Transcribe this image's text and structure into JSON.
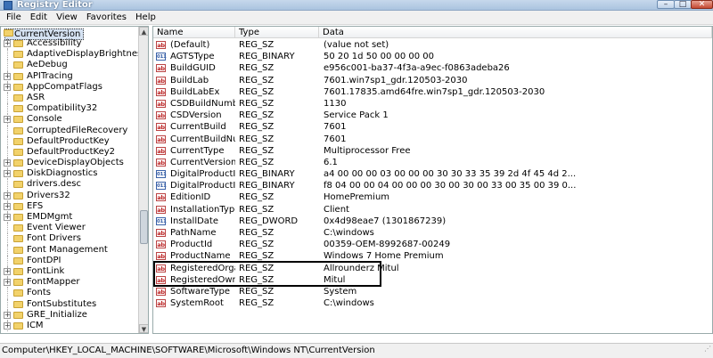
{
  "window": {
    "title": "Registry Editor",
    "min": "–",
    "max": "□",
    "close": "✕"
  },
  "menu": [
    "File",
    "Edit",
    "View",
    "Favorites",
    "Help"
  ],
  "tree": {
    "selected": "CurrentVersion",
    "items": [
      {
        "label": "Accessibility",
        "expandable": true
      },
      {
        "label": "AdaptiveDisplayBrightness",
        "expandable": false
      },
      {
        "label": "AeDebug",
        "expandable": false
      },
      {
        "label": "APITracing",
        "expandable": true
      },
      {
        "label": "AppCompatFlags",
        "expandable": true
      },
      {
        "label": "ASR",
        "expandable": false
      },
      {
        "label": "Compatibility32",
        "expandable": false
      },
      {
        "label": "Console",
        "expandable": true
      },
      {
        "label": "CorruptedFileRecovery",
        "expandable": false
      },
      {
        "label": "DefaultProductKey",
        "expandable": false
      },
      {
        "label": "DefaultProductKey2",
        "expandable": false
      },
      {
        "label": "DeviceDisplayObjects",
        "expandable": true
      },
      {
        "label": "DiskDiagnostics",
        "expandable": true
      },
      {
        "label": "drivers.desc",
        "expandable": false
      },
      {
        "label": "Drivers32",
        "expandable": true
      },
      {
        "label": "EFS",
        "expandable": true
      },
      {
        "label": "EMDMgmt",
        "expandable": true
      },
      {
        "label": "Event Viewer",
        "expandable": false
      },
      {
        "label": "Font Drivers",
        "expandable": false
      },
      {
        "label": "Font Management",
        "expandable": false
      },
      {
        "label": "FontDPI",
        "expandable": false
      },
      {
        "label": "FontLink",
        "expandable": true
      },
      {
        "label": "FontMapper",
        "expandable": true
      },
      {
        "label": "Fonts",
        "expandable": false
      },
      {
        "label": "FontSubstitutes",
        "expandable": false
      },
      {
        "label": "GRE_Initialize",
        "expandable": true
      },
      {
        "label": "ICM",
        "expandable": true
      }
    ]
  },
  "columns": {
    "name": "Name",
    "type": "Type",
    "data": "Data"
  },
  "rows": [
    {
      "icon": "ab",
      "name": "(Default)",
      "type": "REG_SZ",
      "data": "(value not set)"
    },
    {
      "icon": "bin",
      "name": "AGTSType",
      "type": "REG_BINARY",
      "data": "50 20 1d 50 00 00 00 00"
    },
    {
      "icon": "ab",
      "name": "BuildGUID",
      "type": "REG_SZ",
      "data": "e956c001-ba37-4f3a-a9ec-f0863adeba26"
    },
    {
      "icon": "ab",
      "name": "BuildLab",
      "type": "REG_SZ",
      "data": "7601.win7sp1_gdr.120503-2030"
    },
    {
      "icon": "ab",
      "name": "BuildLabEx",
      "type": "REG_SZ",
      "data": "7601.17835.amd64fre.win7sp1_gdr.120503-2030"
    },
    {
      "icon": "ab",
      "name": "CSDBuildNumber",
      "type": "REG_SZ",
      "data": "1130"
    },
    {
      "icon": "ab",
      "name": "CSDVersion",
      "type": "REG_SZ",
      "data": "Service Pack 1"
    },
    {
      "icon": "ab",
      "name": "CurrentBuild",
      "type": "REG_SZ",
      "data": "7601"
    },
    {
      "icon": "ab",
      "name": "CurrentBuildNumber",
      "type": "REG_SZ",
      "data": "7601"
    },
    {
      "icon": "ab",
      "name": "CurrentType",
      "type": "REG_SZ",
      "data": "Multiprocessor Free"
    },
    {
      "icon": "ab",
      "name": "CurrentVersion",
      "type": "REG_SZ",
      "data": "6.1"
    },
    {
      "icon": "bin",
      "name": "DigitalProductId",
      "type": "REG_BINARY",
      "data": "a4 00 00 00 03 00 00 00 30 30 33 35 39 2d 4f 45 4d 2..."
    },
    {
      "icon": "bin",
      "name": "DigitalProductId4",
      "type": "REG_BINARY",
      "data": "f8 04 00 00 04 00 00 00 30 00 30 00 33 00 35 00 39 0..."
    },
    {
      "icon": "ab",
      "name": "EditionID",
      "type": "REG_SZ",
      "data": "HomePremium"
    },
    {
      "icon": "ab",
      "name": "InstallationType",
      "type": "REG_SZ",
      "data": "Client"
    },
    {
      "icon": "bin",
      "name": "InstallDate",
      "type": "REG_DWORD",
      "data": "0x4d98eae7 (1301867239)"
    },
    {
      "icon": "ab",
      "name": "PathName",
      "type": "REG_SZ",
      "data": "C:\\windows"
    },
    {
      "icon": "ab",
      "name": "ProductId",
      "type": "REG_SZ",
      "data": "00359-OEM-8992687-00249"
    },
    {
      "icon": "ab",
      "name": "ProductName",
      "type": "REG_SZ",
      "data": "Windows 7 Home Premium"
    },
    {
      "icon": "ab",
      "name": "RegisteredOrgani...",
      "type": "REG_SZ",
      "data": "Allrounderz Mitul"
    },
    {
      "icon": "ab",
      "name": "RegisteredOwner",
      "type": "REG_SZ",
      "data": "Mitul"
    },
    {
      "icon": "ab",
      "name": "SoftwareType",
      "type": "REG_SZ",
      "data": "System"
    },
    {
      "icon": "ab",
      "name": "SystemRoot",
      "type": "REG_SZ",
      "data": "C:\\windows"
    }
  ],
  "status": "Computer\\HKEY_LOCAL_MACHINE\\SOFTWARE\\Microsoft\\Windows NT\\CurrentVersion"
}
